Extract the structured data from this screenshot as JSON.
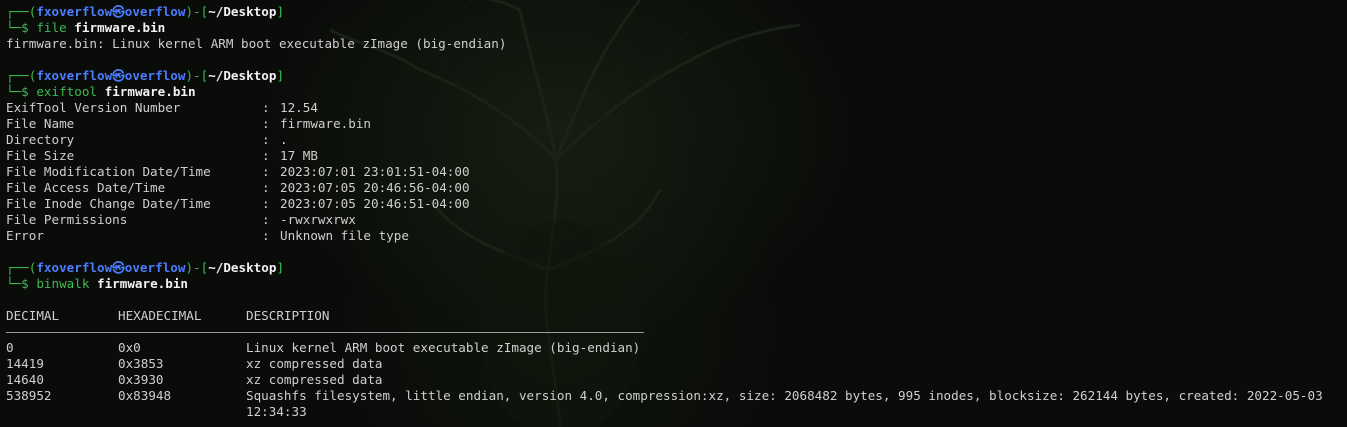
{
  "prompt": {
    "user": "fxoverflow",
    "at_symbol": "㉿",
    "host": "overflow",
    "dir": "~/Desktop",
    "frame_top_left": "┌──(",
    "frame_top_mid": ")-[",
    "frame_top_right": "]",
    "frame_bottom": "└─$ "
  },
  "blocks": [
    {
      "cmd": "file",
      "arg": "firmware.bin",
      "output": "firmware.bin: Linux kernel ARM boot executable zImage (big-endian)"
    },
    {
      "cmd": "exiftool",
      "arg": "firmware.bin",
      "rows": [
        {
          "key": "ExifTool Version Number",
          "value": "12.54"
        },
        {
          "key": "File Name",
          "value": "firmware.bin"
        },
        {
          "key": "Directory",
          "value": "."
        },
        {
          "key": "File Size",
          "value": "17 MB"
        },
        {
          "key": "File Modification Date/Time",
          "value": "2023:07:01 23:01:51-04:00"
        },
        {
          "key": "File Access Date/Time",
          "value": "2023:07:05 20:46:56-04:00"
        },
        {
          "key": "File Inode Change Date/Time",
          "value": "2023:07:05 20:46:51-04:00"
        },
        {
          "key": "File Permissions",
          "value": "-rwxrwxrwx"
        },
        {
          "key": "Error",
          "value": "Unknown file type"
        }
      ]
    },
    {
      "cmd": "binwalk",
      "arg": "firmware.bin",
      "headers": [
        "DECIMAL",
        "HEXADECIMAL",
        "DESCRIPTION"
      ],
      "rows": [
        [
          "0",
          "0x0",
          "Linux kernel ARM boot executable zImage (big-endian)"
        ],
        [
          "14419",
          "0x3853",
          "xz compressed data"
        ],
        [
          "14640",
          "0x3930",
          "xz compressed data"
        ],
        [
          "538952",
          "0x83948",
          "Squashfs filesystem, little endian, version 4.0, compression:xz, size: 2068482 bytes, 995 inodes, blocksize: 262144 bytes, created: 2022-05-03 12:34:33"
        ]
      ]
    }
  ],
  "colors": {
    "prompt_frame": "#3fb950",
    "user_host": "#4c7cff",
    "dir": "#f2f2f2",
    "command": "#3fb950",
    "background": "#0a0c09"
  }
}
